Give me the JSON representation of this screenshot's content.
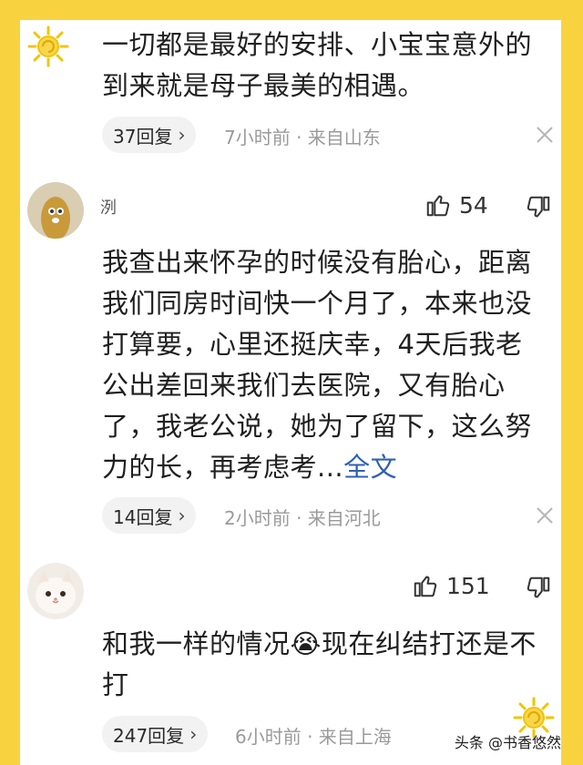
{
  "comments": [
    {
      "text": "一切都是最好的安排、小宝宝意外的到来就是母子最美的相遇。",
      "reply_label": "37回复",
      "meta": "7小时前 · 来自山东"
    },
    {
      "username": "洌",
      "likes": "54",
      "text": "我查出来怀孕的时候没有胎心，距离我们同房时间快一个月了，本来也没打算要，心里还挺庆幸，4天后我老公出差回来我们去医院，又有胎心了，我老公说，她为了留下，这么努力的长，再考虑考...",
      "more_label": "全文",
      "reply_label": "14回复",
      "meta": "2小时前 · 来自河北"
    },
    {
      "username": "",
      "likes": "151",
      "text": "和我一样的情况😭现在纠结打还是不打",
      "reply_label": "247回复",
      "meta": "6小时前 · 来自上海"
    }
  ],
  "watermark": "头条 @书香悠然",
  "colors": {
    "background": "#f9d33f",
    "card": "#ffffff",
    "link": "#2f5fb3"
  },
  "icons": [
    "sun-icon",
    "chevron-right-icon",
    "close-icon",
    "thumbs-up-icon",
    "thumbs-down-icon"
  ]
}
